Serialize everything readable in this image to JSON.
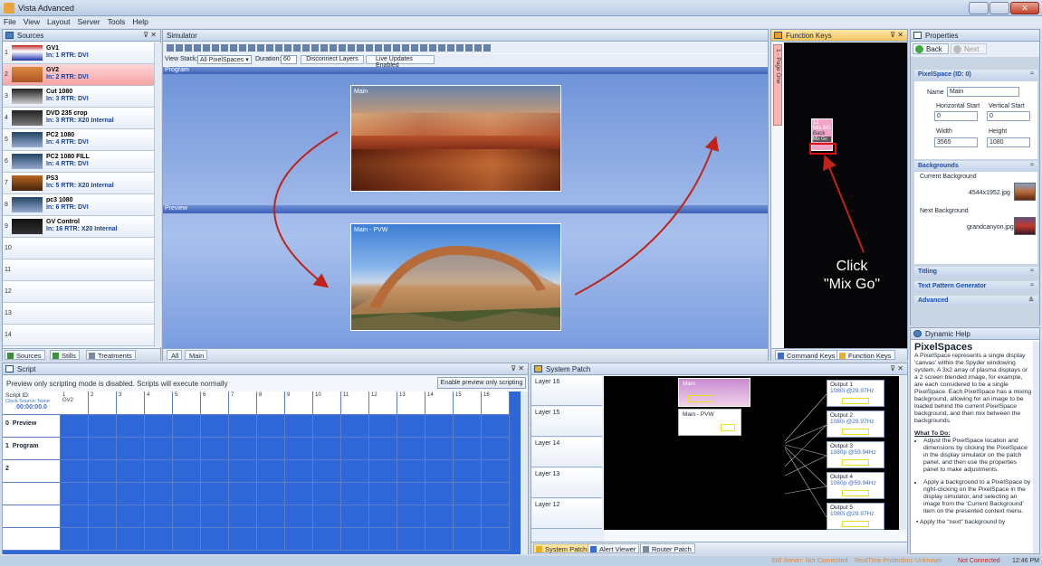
{
  "app": {
    "title": "Vista Advanced"
  },
  "menu": [
    "File",
    "View",
    "Layout",
    "Server",
    "Tools",
    "Help"
  ],
  "sources": {
    "header": "Sources",
    "items": [
      {
        "num": "1",
        "name": "GV1",
        "route": "In: 1 RTR: DVI"
      },
      {
        "num": "2",
        "name": "GV2",
        "route": "In: 2 RTR: DVI"
      },
      {
        "num": "3",
        "name": "Cut 1080",
        "route": "In: 3 RTR: DVI"
      },
      {
        "num": "4",
        "name": "DVD 235 crop",
        "route": "In: 3 RTR: X20 Internal"
      },
      {
        "num": "5",
        "name": "PC2 1080",
        "route": "In: 4 RTR: DVI"
      },
      {
        "num": "6",
        "name": "PC2 1080 FILL",
        "route": "In: 4 RTR: DVI"
      },
      {
        "num": "7",
        "name": "PS3",
        "route": "In: 5 RTR: X20 Internal"
      },
      {
        "num": "8",
        "name": "pc3 1080",
        "route": "In: 6 RTR: DVI"
      },
      {
        "num": "9",
        "name": "GV Control",
        "route": "In: 16 RTR: X20 Internal"
      }
    ],
    "empty": [
      "10",
      "11",
      "12",
      "13",
      "14"
    ],
    "tabs": [
      "Sources",
      "Stills",
      "Treatments"
    ]
  },
  "simulator": {
    "header": "Simulator",
    "view_stack_label": "View Stack:",
    "view_stack_value": "All PixelSpaces",
    "duration_label": "Duration:",
    "duration_value": "60",
    "disconnect": "Disconnect Layers",
    "live_updates": "Live Updates Enabled",
    "program": "Program",
    "preview": "Preview",
    "main_label": "Main",
    "pvw_label": "Main - PVW",
    "tabs": [
      "All",
      "Main"
    ]
  },
  "function_keys": {
    "header": "Function Keys",
    "page_tab": "1 - Page One",
    "key_items": [
      "12",
      "Mix BG",
      "Back",
      "Mix Go"
    ],
    "annotation": "Click\n\"Mix Go\"",
    "tabs": [
      "Command Keys",
      "Function Keys"
    ]
  },
  "properties": {
    "header": "Properties",
    "back": "Back",
    "next": "Next",
    "section_pixelspace": "PixelSpace (ID: 0)",
    "name_label": "Name",
    "name_value": "Main",
    "hstart_label": "Horizontal Start",
    "hstart_value": "0",
    "vstart_label": "Vertical Start",
    "vstart_value": "0",
    "width_label": "Width",
    "width_value": "3565",
    "height_label": "Height",
    "height_value": "1080",
    "section_backgrounds": "Backgrounds",
    "current_bg_label": "Current Background",
    "current_bg_file": "4544x1952.jpg",
    "next_bg_label": "Next Background",
    "next_bg_file": "grandcanyon.jpg",
    "section_titling": "Titling",
    "section_tpg": "Text Pattern Generator",
    "section_advanced": "Advanced"
  },
  "help": {
    "header": "Dynamic Help",
    "title": "PixelSpaces",
    "body": "A PixelSpace represents a single display 'canvas' within the Spyder windowing system.  A 3x2 array of plasma displays or a 2 screen blended image, for example, are each considered to be a single PixelSpace. Each PixelSpace has a mixing background, allowing for an image to be loaded behind the current PixelSpace background, and then mix between the backgrounds.",
    "what_title": "What To Do:",
    "bullets": [
      "Adjust the PixelSpace location and dimensions by clicking the PixelSpace in the display simulator on the patch panel, and then use the properties panel to make adjustments.",
      "Apply a background to a PixelSpace by right-clicking on the PixelSpace in the display simulator, and selecting an image from the 'Current Background' item on the presented context menu."
    ],
    "trailing": "• Apply the \"next\" background by"
  },
  "script": {
    "header": "Script",
    "notice": "Preview only scripting mode is disabled.  Scripts will execute normally",
    "enable_btn": "Enable preview only scripting",
    "script_id": "Script ID:",
    "clock": "Clock Source: None",
    "time": "00:00:00.0",
    "cues": [
      "1",
      "2",
      "3",
      "4",
      "5",
      "6",
      "7",
      "8",
      "9",
      "10",
      "11",
      "12",
      "13",
      "14",
      "15",
      "16"
    ],
    "cue1_label": "GV2",
    "rows": [
      {
        "n": "0",
        "label": "Preview"
      },
      {
        "n": "1",
        "label": "Program"
      },
      {
        "n": "2",
        "label": ""
      }
    ]
  },
  "patch": {
    "header": "System Patch",
    "layers": [
      "Layer 16",
      "Layer 15",
      "Layer 14",
      "Layer 13",
      "Layer 12"
    ],
    "ps_main": "Main",
    "ps_pvw": "Main - PVW",
    "outputs": [
      {
        "name": "Output 1",
        "fmt": "1080i @29.97Hz"
      },
      {
        "name": "Output 2",
        "fmt": "1080i @29.97Hz"
      },
      {
        "name": "Output 3",
        "fmt": "1080p @59.94Hz"
      },
      {
        "name": "Output 4",
        "fmt": "1080p @59.94Hz"
      },
      {
        "name": "Output 5",
        "fmt": "1080i @29.97Hz"
      }
    ],
    "tabs": [
      "System Patch",
      "Alert Viewer",
      "Router Patch"
    ]
  },
  "status": {
    "still_server": "Still Server: Not Connected",
    "realtime": "RealTime Protection: Unknown",
    "conn": "Not Connected",
    "clock": "12:46 PM"
  }
}
